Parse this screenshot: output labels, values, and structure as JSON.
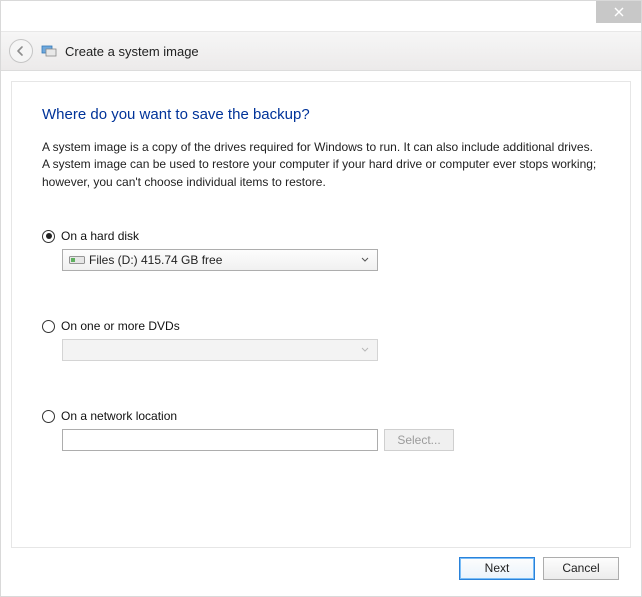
{
  "window": {
    "title": "Create a system image"
  },
  "page": {
    "heading": "Where do you want to save the backup?",
    "description": "A system image is a copy of the drives required for Windows to run. It can also include additional drives. A system image can be used to restore your computer if your hard drive or computer ever stops working; however, you can't choose individual items to restore."
  },
  "options": {
    "hard_disk": {
      "label": "On a hard disk",
      "selected": true,
      "drive_display": "Files (D:)  415.74 GB free"
    },
    "dvd": {
      "label": "On one or more DVDs",
      "selected": false,
      "drive_display": ""
    },
    "network": {
      "label": "On a network location",
      "selected": false,
      "path": "",
      "select_button": "Select..."
    }
  },
  "footer": {
    "next": "Next",
    "cancel": "Cancel"
  }
}
